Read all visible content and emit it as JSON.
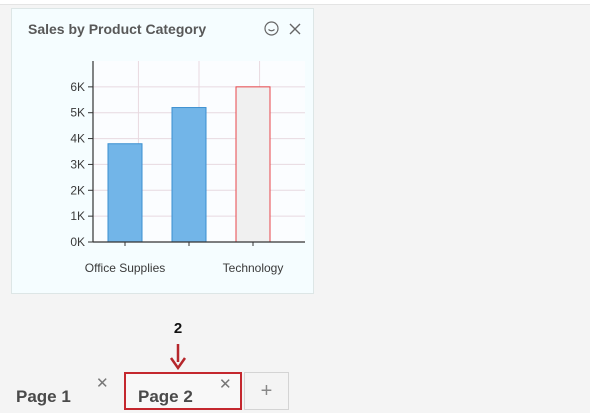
{
  "widget": {
    "title": "Sales by Product Category",
    "actions": {
      "menu_icon": "smiley-circle-icon",
      "close_icon": "close-icon"
    }
  },
  "chart_data": {
    "type": "bar",
    "categories": [
      "Office Supplies",
      "",
      "Technology"
    ],
    "values": [
      3800,
      5200,
      6000
    ],
    "value_unit_suffix": "K",
    "yticks": [
      0,
      1000,
      2000,
      3000,
      4000,
      5000,
      6000
    ],
    "ylim": [
      0,
      7000
    ],
    "grid": true,
    "title": "",
    "xlabel": "",
    "ylabel": "",
    "colors": {
      "bar_fill": "#72b5e8",
      "bar_stroke": "#3a8fd0",
      "highlight_fill": "#f0f0f0",
      "highlight_stroke": "#e8454a",
      "grid": "#e8d9e0",
      "axis": "#333333"
    },
    "highlighted_index": 2
  },
  "tabs": {
    "items": [
      {
        "label": "Page 1",
        "close_icon": "close-icon",
        "selected": false
      },
      {
        "label": "Page 2",
        "close_icon": "close-icon",
        "selected": true
      }
    ],
    "add_icon": "plus-icon",
    "add_label": "+"
  },
  "annotation": {
    "number": "2",
    "color": "#b5262b",
    "arrow_icon": "arrow-down-icon"
  }
}
